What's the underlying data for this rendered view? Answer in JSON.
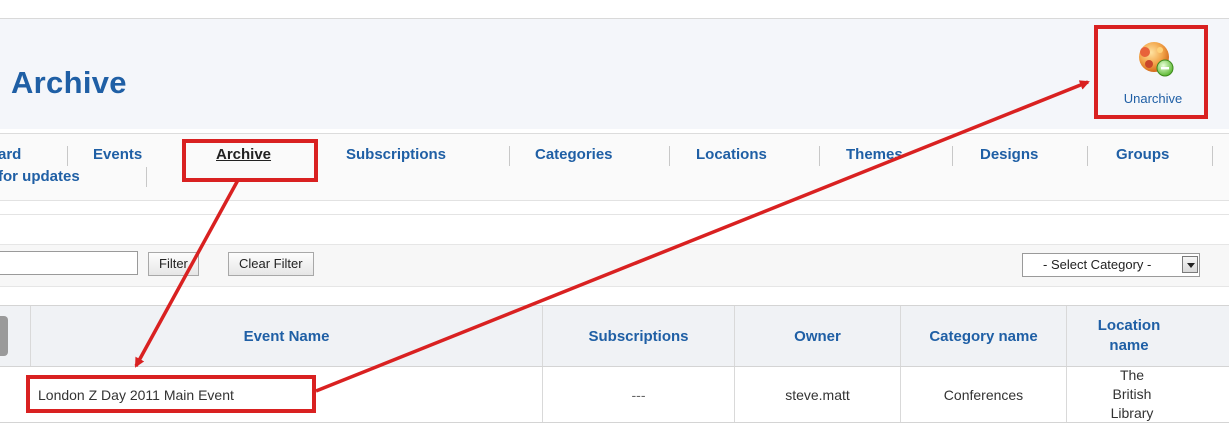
{
  "header": {
    "title": "Archive",
    "toolbar": {
      "unarchive_label": "Unarchive"
    }
  },
  "nav": {
    "items": [
      {
        "label": "ard"
      },
      {
        "label": "Events"
      },
      {
        "label": "Archive"
      },
      {
        "label": "Subscriptions"
      },
      {
        "label": "Categories"
      },
      {
        "label": "Locations"
      },
      {
        "label": "Themes"
      },
      {
        "label": "Designs"
      },
      {
        "label": "Groups"
      },
      {
        "label": "for updates"
      }
    ],
    "active": "Archive"
  },
  "filter": {
    "search_value": "",
    "filter_label": "Filter",
    "clear_label": "Clear Filter",
    "category_select": "- Select Category -"
  },
  "table": {
    "headers": [
      "Event Name",
      "Subscriptions",
      "Owner",
      "Category name",
      "Location name"
    ],
    "rows": [
      {
        "event_name": "London Z Day 2011 Main Event",
        "subscriptions": "---",
        "owner": "steve.matt",
        "category": "Conferences",
        "location": "The British Library"
      }
    ]
  },
  "colors": {
    "accent": "#1f5fa5",
    "highlight": "#d92121",
    "header_bg": "#f4f6fa"
  },
  "icons": [
    "unarchive-icon",
    "dropdown-arrow-icon"
  ]
}
